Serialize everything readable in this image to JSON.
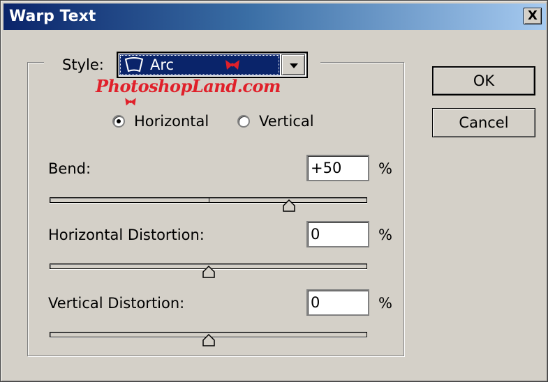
{
  "window": {
    "title": "Warp Text",
    "close_label": "X"
  },
  "style": {
    "label": "Style:",
    "value": "Arc",
    "icon": "arc-icon"
  },
  "watermark": "PhotoshopLand.com",
  "orientation": {
    "options": [
      "Horizontal",
      "Vertical"
    ],
    "selected": "Horizontal"
  },
  "bend": {
    "label": "Bend:",
    "value": "+50",
    "unit": "%",
    "slider_value": 50
  },
  "horizontal_distortion": {
    "label": "Horizontal Distortion:",
    "value": "0",
    "unit": "%",
    "slider_value": 0
  },
  "vertical_distortion": {
    "label": "Vertical Distortion:",
    "value": "0",
    "unit": "%",
    "slider_value": 0
  },
  "buttons": {
    "ok": "OK",
    "cancel": "Cancel"
  },
  "colors": {
    "face": "#d4d0c8",
    "title_start": "#0a246a",
    "title_end": "#a6caf0",
    "selection": "#0a246a",
    "watermark": "#e0202a"
  }
}
